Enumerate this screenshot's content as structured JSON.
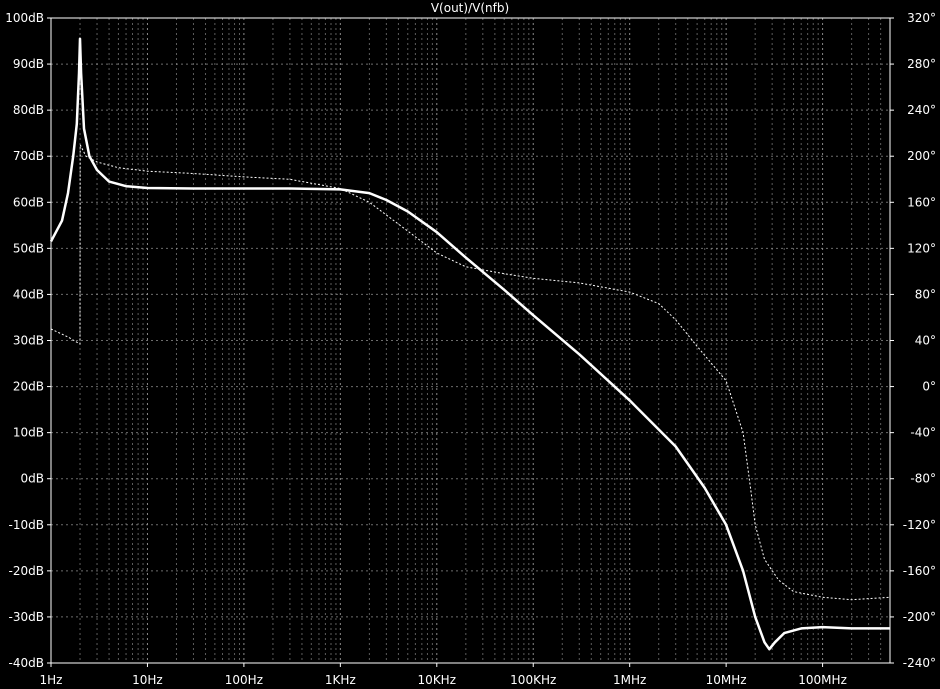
{
  "chart_data": {
    "type": "line",
    "title": "V(out)/V(nfb)",
    "x_scale": "log",
    "xlim": [
      1,
      500000000
    ],
    "x_ticks": [
      1,
      10,
      100,
      1000,
      10000,
      100000,
      1000000,
      10000000,
      100000000
    ],
    "x_tick_labels": [
      "1Hz",
      "10Hz",
      "100Hz",
      "1KHz",
      "10KHz",
      "100KHz",
      "1MHz",
      "10MHz",
      "100MHz"
    ],
    "ylim_left": [
      -40,
      100
    ],
    "y_ticks_left": [
      100,
      90,
      80,
      70,
      60,
      50,
      40,
      30,
      20,
      10,
      0,
      -10,
      -20,
      -30,
      -40
    ],
    "y_tick_labels_left": [
      "100dB",
      "90dB",
      "80dB",
      "70dB",
      "60dB",
      "50dB",
      "40dB",
      "30dB",
      "20dB",
      "10dB",
      "0dB",
      "-10dB",
      "-20dB",
      "-30dB",
      "-40dB"
    ],
    "ylim_right": [
      -240,
      320
    ],
    "y_ticks_right": [
      320,
      280,
      240,
      200,
      160,
      120,
      80,
      40,
      0,
      -40,
      -80,
      -120,
      -160,
      -200,
      -240
    ],
    "y_tick_labels_right": [
      "320°",
      "280°",
      "240°",
      "200°",
      "160°",
      "120°",
      "80°",
      "40°",
      "0°",
      "-40°",
      "-80°",
      "-120°",
      "-160°",
      "-200°",
      "-240°"
    ],
    "grid": true,
    "series": [
      {
        "axis": "left",
        "style": "solid",
        "color": "#ffffff",
        "points": [
          [
            1,
            51.5
          ],
          [
            1.3,
            56
          ],
          [
            1.5,
            62
          ],
          [
            1.7,
            70
          ],
          [
            1.85,
            77
          ],
          [
            1.95,
            88
          ],
          [
            2.0,
            95.5
          ],
          [
            2.05,
            88
          ],
          [
            2.2,
            76
          ],
          [
            2.5,
            70
          ],
          [
            3,
            67
          ],
          [
            4,
            64.5
          ],
          [
            6,
            63.5
          ],
          [
            10,
            63.1
          ],
          [
            30,
            63
          ],
          [
            100,
            63
          ],
          [
            300,
            63
          ],
          [
            1000,
            62.8
          ],
          [
            2000,
            62
          ],
          [
            3000,
            60.5
          ],
          [
            5000,
            58
          ],
          [
            10000,
            53.5
          ],
          [
            20000,
            48
          ],
          [
            50000,
            41
          ],
          [
            100000,
            35.5
          ],
          [
            300000,
            27
          ],
          [
            1000000,
            17
          ],
          [
            3000000,
            7
          ],
          [
            6000000,
            -2
          ],
          [
            10000000,
            -10
          ],
          [
            15000000,
            -20
          ],
          [
            20000000,
            -30
          ],
          [
            25000000,
            -35.5
          ],
          [
            28000000,
            -37
          ],
          [
            32000000,
            -35.5
          ],
          [
            40000000,
            -33.5
          ],
          [
            60000000,
            -32.5
          ],
          [
            100000000,
            -32.2
          ],
          [
            200000000,
            -32.5
          ],
          [
            500000000,
            -32.5
          ]
        ]
      },
      {
        "axis": "right",
        "style": "dashed",
        "color": "#ffffff",
        "points": [
          [
            1,
            50
          ],
          [
            1.5,
            43
          ],
          [
            2.0,
            37
          ],
          [
            2.01,
            210
          ],
          [
            2.3,
            200
          ],
          [
            3,
            195
          ],
          [
            5,
            190
          ],
          [
            10,
            187
          ],
          [
            30,
            185
          ],
          [
            100,
            182
          ],
          [
            300,
            180
          ],
          [
            1000,
            172
          ],
          [
            2000,
            160
          ],
          [
            5000,
            135
          ],
          [
            10000,
            116
          ],
          [
            20000,
            104
          ],
          [
            50000,
            98
          ],
          [
            100000,
            94
          ],
          [
            300000,
            90
          ],
          [
            1000000,
            82
          ],
          [
            2000000,
            72
          ],
          [
            3000000,
            58
          ],
          [
            5000000,
            35
          ],
          [
            10000000,
            5
          ],
          [
            15000000,
            -40
          ],
          [
            18000000,
            -90
          ],
          [
            20000000,
            -120
          ],
          [
            25000000,
            -150
          ],
          [
            35000000,
            -168
          ],
          [
            50000000,
            -178
          ],
          [
            100000000,
            -183
          ],
          [
            200000000,
            -185
          ],
          [
            500000000,
            -183
          ]
        ]
      }
    ]
  }
}
